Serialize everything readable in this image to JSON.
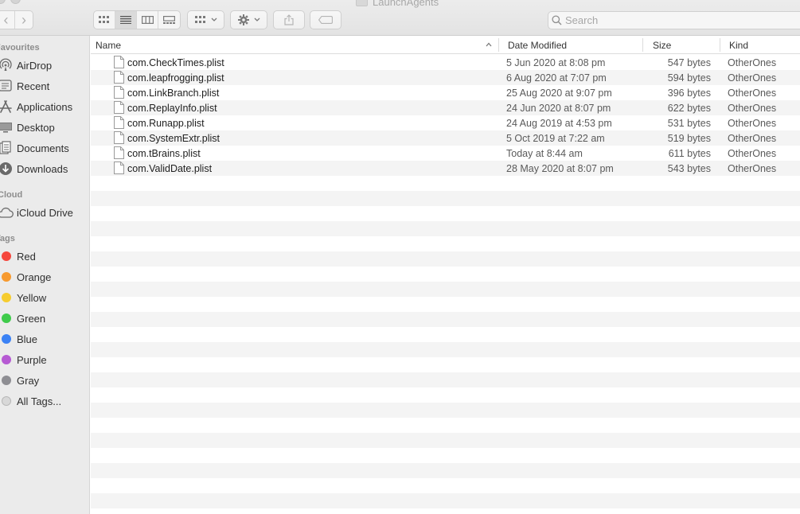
{
  "window": {
    "title": "LaunchAgents"
  },
  "toolbar": {
    "back_label": "‹",
    "forward_label": "›",
    "search_placeholder": "Search"
  },
  "sidebar": {
    "favourites_heading": "Favourites",
    "favourites": [
      {
        "label": "AirDrop",
        "icon": "airdrop-icon"
      },
      {
        "label": "Recent",
        "icon": "recent-icon"
      },
      {
        "label": "Applications",
        "icon": "applications-icon"
      },
      {
        "label": "Desktop",
        "icon": "desktop-icon"
      },
      {
        "label": "Documents",
        "icon": "documents-icon"
      },
      {
        "label": "Downloads",
        "icon": "downloads-icon"
      }
    ],
    "icloud_heading": "iCloud",
    "icloud": [
      {
        "label": "iCloud Drive",
        "icon": "cloud-icon"
      }
    ],
    "tags_heading": "Tags",
    "tags": [
      {
        "label": "Red",
        "color": "#f5473d"
      },
      {
        "label": "Orange",
        "color": "#f79a2f"
      },
      {
        "label": "Yellow",
        "color": "#f6cc2f"
      },
      {
        "label": "Green",
        "color": "#3fcb4b"
      },
      {
        "label": "Blue",
        "color": "#3b82f5"
      },
      {
        "label": "Purple",
        "color": "#b65ad3"
      },
      {
        "label": "Gray",
        "color": "#8e8e93"
      },
      {
        "label": "All Tags...",
        "color": "#d8d8d8"
      }
    ]
  },
  "columns": {
    "name": "Name",
    "date": "Date Modified",
    "size": "Size",
    "kind": "Kind"
  },
  "files": [
    {
      "name": "com.CheckTimes.plist",
      "date": "5 Jun 2020 at 8:08 pm",
      "size": "547 bytes",
      "kind": "OtherOnes"
    },
    {
      "name": "com.leapfrogging.plist",
      "date": "6 Aug 2020 at 7:07 pm",
      "size": "594 bytes",
      "kind": "OtherOnes"
    },
    {
      "name": "com.LinkBranch.plist",
      "date": "25 Aug 2020 at 9:07 pm",
      "size": "396 bytes",
      "kind": "OtherOnes"
    },
    {
      "name": "com.ReplayInfo.plist",
      "date": "24 Jun 2020 at 8:07 pm",
      "size": "622 bytes",
      "kind": "OtherOnes"
    },
    {
      "name": "com.Runapp.plist",
      "date": "24 Aug 2019 at 4:53 pm",
      "size": "531 bytes",
      "kind": "OtherOnes"
    },
    {
      "name": "com.SystemExtr.plist",
      "date": "5 Oct 2019 at 7:22 am",
      "size": "519 bytes",
      "kind": "OtherOnes"
    },
    {
      "name": "com.tBrains.plist",
      "date": "Today at 8:44 am",
      "size": "611 bytes",
      "kind": "OtherOnes"
    },
    {
      "name": "com.ValidDate.plist",
      "date": "28 May 2020 at 8:07 pm",
      "size": "543 bytes",
      "kind": "OtherOnes"
    }
  ]
}
